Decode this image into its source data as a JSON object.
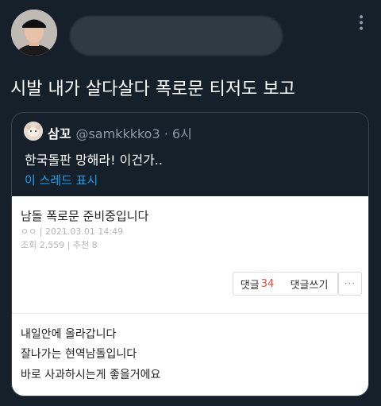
{
  "tweet": {
    "text": "시발 내가 살다살다 폭로문 티저도 보고",
    "more_icon": "more-vertical-icon"
  },
  "quote": {
    "name": "삼꼬",
    "handle_time": "@samkkkko3 · 6시",
    "text": "한국돌판 망해라! 이건가..",
    "show_thread": "이 스레드 표시"
  },
  "post": {
    "title": "남돌 폭로문 준비중입니다",
    "meta_line1": "ㅇㅇ  | 2021.03.01 14:49",
    "meta_line2": "조회 2,559 | 추천 8",
    "comment_label": "댓글",
    "comment_count": "34",
    "write_comment": "댓글쓰기",
    "more": "···",
    "body": [
      "내일안에 올라갑니다",
      "잘나가는 현역남돌입니다",
      "바로 사과하시는게 좋을거에요"
    ]
  },
  "colors": {
    "background": "#15202b",
    "link": "#1da1f2",
    "comment_count": "#e14b3b"
  }
}
